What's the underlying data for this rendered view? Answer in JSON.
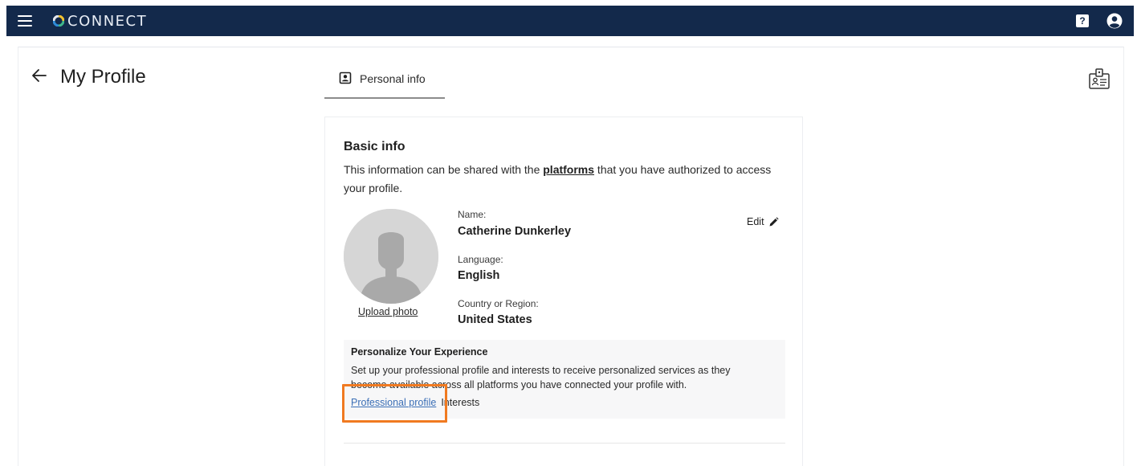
{
  "app": {
    "brand_name": "CONNECT",
    "brand_color": "#13294b",
    "help_label": "?"
  },
  "page": {
    "title": "My Profile"
  },
  "tabs": [
    {
      "label": "Personal info",
      "active": true
    }
  ],
  "basic_info": {
    "title": "Basic info",
    "desc_before": "This information can be shared with the ",
    "desc_link": "platforms",
    "desc_after": " that you have authorized to access your profile.",
    "upload_label": "Upload photo",
    "edit_label": "Edit",
    "fields": [
      {
        "label": "Name:",
        "value": "Catherine Dunkerley"
      },
      {
        "label": "Language:",
        "value": "English"
      },
      {
        "label": "Country or Region:",
        "value": "United States"
      }
    ]
  },
  "personalize": {
    "title": "Personalize Your Experience",
    "desc": "Set up your professional profile and interests to receive personalized services as they become available across all platforms you have connected your profile with.",
    "links": [
      "Professional profile",
      "Interests"
    ]
  },
  "colors": {
    "highlight": "#f07a21",
    "link": "#3b6fb6"
  },
  "icons": [
    "hamburger-menu-icon",
    "connect-logo-icon",
    "help-icon",
    "account-icon",
    "back-arrow-icon",
    "id-card-icon",
    "id-badge-icon",
    "user-silhouette-icon",
    "pencil-icon"
  ]
}
